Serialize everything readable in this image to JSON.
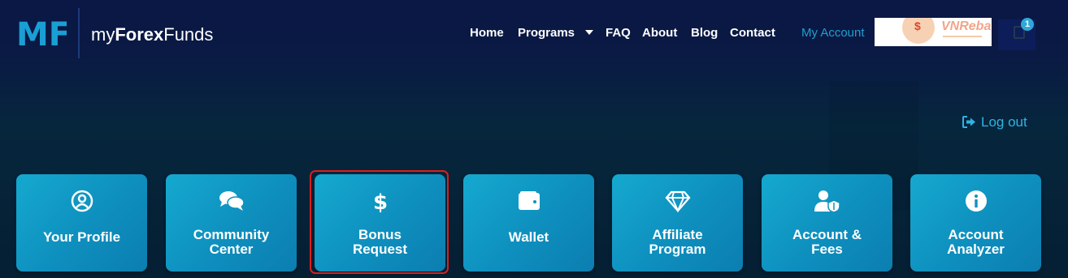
{
  "brand": {
    "name_prefix": "my",
    "name_bold": "Forex",
    "name_suffix": "Funds",
    "logo_text": "MFF"
  },
  "nav": {
    "items": [
      {
        "label": "Home"
      },
      {
        "label": "Programs"
      },
      {
        "label": "FAQ"
      },
      {
        "label": "About"
      },
      {
        "label": "Blog"
      },
      {
        "label": "Contact"
      }
    ],
    "account_label": "My Account",
    "cart_count": "1"
  },
  "watermark": {
    "logo_text": "VNRebate"
  },
  "logout_label": "Log out",
  "cards": [
    {
      "label": "Your Profile",
      "icon": "user-circle-icon"
    },
    {
      "label": "Community Center",
      "icon": "comments-icon"
    },
    {
      "label": "Bonus Request",
      "icon": "dollar-icon",
      "highlighted": true
    },
    {
      "label": "Wallet",
      "icon": "wallet-icon"
    },
    {
      "label": "Affiliate Program",
      "icon": "diamond-icon"
    },
    {
      "label": "Account & Fees",
      "icon": "user-shield-icon"
    },
    {
      "label": "Account Analyzer",
      "icon": "info-circle-icon"
    }
  ],
  "colors": {
    "accent": "#1f9fd0",
    "card": "#0e8fbe",
    "highlight": "#d8201f"
  }
}
